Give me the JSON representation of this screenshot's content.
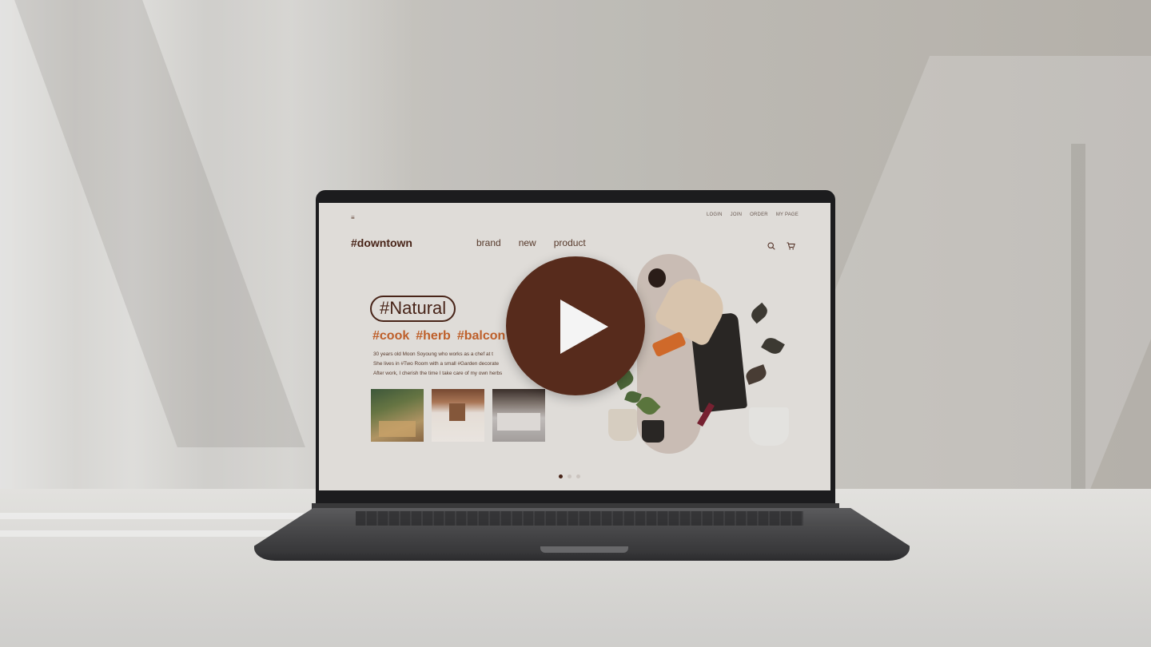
{
  "site": {
    "logo": "#downtown",
    "hamburger": "≡",
    "top_menu": [
      "LOGIN",
      "JOIN",
      "ORDER",
      "MY PAGE"
    ],
    "nav": [
      "brand",
      "new",
      "product"
    ],
    "header_icons": [
      "search-icon",
      "cart-icon"
    ]
  },
  "hero": {
    "headline": "#Natural",
    "tags": [
      "#cook",
      "#herb",
      "#balcon"
    ],
    "description": [
      "30 years old Moon Soyoung who works as a chef at t",
      "She lives in #Two Room with a small #Garden decorate",
      "After work, I cherish the time I take care of my own herbs"
    ],
    "thumbnails": [
      "living-room-photo",
      "kitchen-photo",
      "bedroom-photo"
    ],
    "carousel": {
      "total": 3,
      "active": 1
    }
  },
  "player": {
    "icon": "play-icon"
  },
  "colors": {
    "brand": "#4a2418",
    "accent": "#c7632b",
    "play": "#5a2c1c",
    "screen_bg": "#e9e6e2"
  }
}
